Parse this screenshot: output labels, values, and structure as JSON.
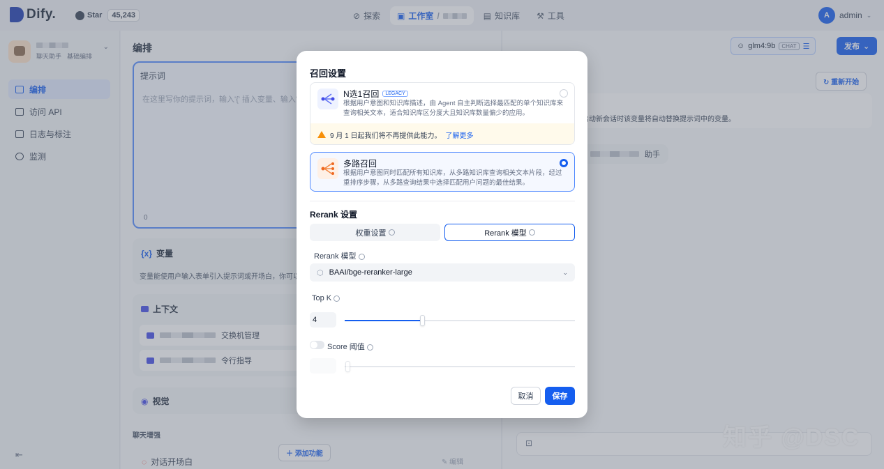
{
  "brand": {
    "name": "Dify.",
    "github_label": "Star",
    "stars": "45,243"
  },
  "nav": {
    "explore": "探索",
    "studio": "工作室",
    "knowledge": "知识库",
    "tools": "工具"
  },
  "user": {
    "initial": "A",
    "name": "admin"
  },
  "sidebar": {
    "app_tags": [
      "聊天助手",
      "基础编排"
    ],
    "items": [
      {
        "label": "编排"
      },
      {
        "label": "访问 API"
      },
      {
        "label": "日志与标注"
      },
      {
        "label": "监测"
      }
    ]
  },
  "editor": {
    "title": "编排",
    "prompt_label": "提示词",
    "prompt_placeholder": "在这里写你的提示词，输入'{' 插入变量、输入'/'",
    "char_count": "0",
    "variables_label": "变量",
    "variables_desc": "变量能使用户输入表单引入提示词或开场白，你可以试",
    "context_label": "上下文",
    "context_items": [
      "交换机管理",
      "令行指导"
    ],
    "vision_label": "视觉",
    "chat_enhance_label": "聊天增强",
    "add_feature": "添加功能",
    "opener_label": "对话开场白",
    "edit_label": "编辑"
  },
  "debug": {
    "model": "glm4:9b",
    "model_mode": "CHAT",
    "publish": "发布",
    "restart": "重新开始",
    "var_notice": "启动新会话时该变量将自动替换提示词中的变量。",
    "assistant_suffix": "助手"
  },
  "watermark": "知乎 @DSC",
  "modal": {
    "title": "召回设置",
    "option_single": {
      "title": "N选1召回",
      "badge": "LEGACY",
      "desc": "根据用户意图和知识库描述，由 Agent 自主判断选择最匹配的单个知识库来查询相关文本，适合知识库区分度大且知识库数量偏少的应用。",
      "warning": "9 月 1 日起我们将不再提供此能力。",
      "learn_more": "了解更多"
    },
    "option_multi": {
      "title": "多路召回",
      "desc": "根据用户意图同时匹配所有知识库，从多路知识库查询相关文本片段，经过重排序步骤，从多路查询结果中选择匹配用户问题的最佳结果。"
    },
    "rerank_title": "Rerank 设置",
    "tab_weight": "权重设置",
    "tab_rerank": "Rerank 模型",
    "rerank_model_label": "Rerank 模型",
    "rerank_model_value": "BAAI/bge-reranker-large",
    "topk_label": "Top K",
    "topk_value": "4",
    "score_label": "Score 阈值",
    "cancel": "取消",
    "save": "保存"
  },
  "colors": {
    "primary": "#155eef",
    "warning": "#f79009"
  }
}
